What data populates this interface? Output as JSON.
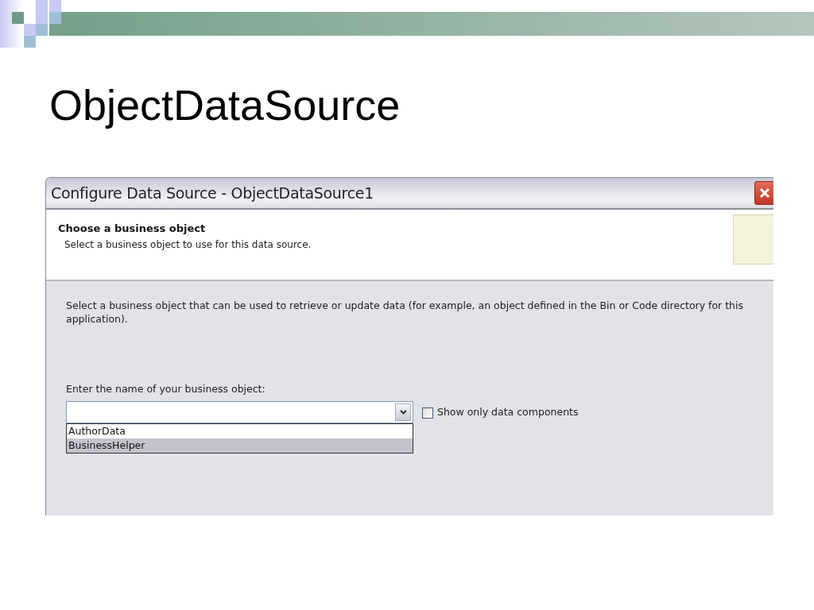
{
  "slide": {
    "title": "ObjectDataSource"
  },
  "window": {
    "title": "Configure Data Source - ObjectDataSource1"
  },
  "header": {
    "heading": "Choose a business object",
    "subtitle": "Select a business object to use for this data source."
  },
  "description": "Select a business object that can be used to retrieve or update data (for example, an object defined in the Bin or Code directory for this application).",
  "object_field": {
    "label": "Enter the name of your business object:",
    "expanded": true,
    "options": [
      {
        "label": "AuthorData",
        "selected": false
      },
      {
        "label": "BusinessHelper",
        "selected": true
      }
    ]
  },
  "checkbox": {
    "label": "Show only data components",
    "checked": false
  }
}
